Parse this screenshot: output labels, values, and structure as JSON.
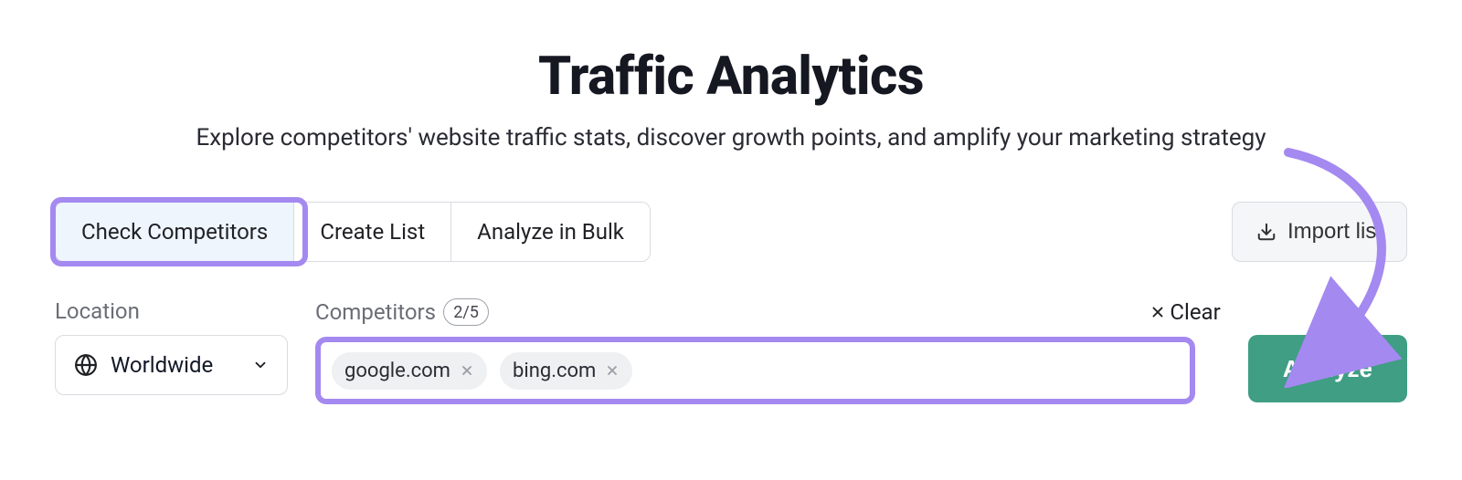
{
  "header": {
    "title": "Traffic Analytics",
    "subtitle": "Explore competitors' website traffic stats, discover growth points, and amplify your marketing strategy"
  },
  "tabs": {
    "items": [
      {
        "label": "Check Competitors",
        "active": true
      },
      {
        "label": "Create List",
        "active": false
      },
      {
        "label": "Analyze in Bulk",
        "active": false
      }
    ]
  },
  "import_button": {
    "label": "Import list"
  },
  "location": {
    "label": "Location",
    "value": "Worldwide"
  },
  "competitors": {
    "label": "Competitors",
    "count_badge": "2/5",
    "clear_label": "Clear",
    "chips": [
      "google.com",
      "bing.com"
    ]
  },
  "analyze_button": {
    "label": "Analyze"
  },
  "colors": {
    "highlight": "#a489f0",
    "primary_action": "#3f9e83"
  }
}
